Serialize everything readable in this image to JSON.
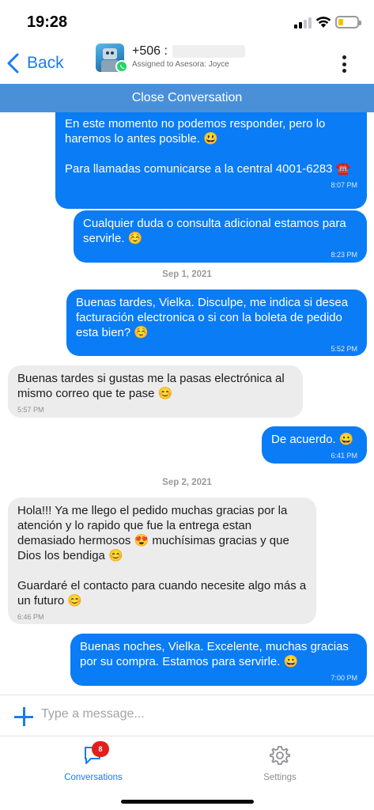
{
  "status_bar": {
    "time": "19:28"
  },
  "header": {
    "back_label": "Back",
    "contact_name": "+506 :",
    "assigned_to": "Assigned to Asesora: Joyce",
    "icons": {
      "back": "chevron-left-icon",
      "more": "vertical-dots-icon",
      "channel": "whatsapp-icon"
    }
  },
  "close_bar": {
    "label": "Close Conversation"
  },
  "messages": [
    {
      "direction": "out",
      "text": "En este momento no podemos responder, pero lo haremos lo antes posible. 😃\n\nPara llamadas comunicarse a la central 4001-6283 ☎️",
      "time": "8:07 PM"
    },
    {
      "direction": "out",
      "text": "Cualquier duda o consulta adicional estamos para servirle. ☺️",
      "time": "8:23 PM"
    },
    {
      "type": "date",
      "text": "Sep 1, 2021"
    },
    {
      "direction": "out",
      "text": "Buenas tardes, Vielka. Disculpe, me indica si desea facturación electronica o si con la boleta de pedido esta bien? ☺️",
      "time": "5:52 PM"
    },
    {
      "direction": "in",
      "text": "Buenas tardes si gustas me la pasas electrónica al mismo correo que te pase 😊",
      "time": "5:57 PM"
    },
    {
      "direction": "out",
      "text": "De acuerdo. 😀",
      "time": "6:41 PM"
    },
    {
      "type": "date",
      "text": "Sep 2, 2021"
    },
    {
      "direction": "in",
      "text": "Hola!!! Ya me llego el pedido muchas gracias por la atención y lo  rapido que fue la entrega estan demasiado hermosos 😍 muchísimas gracias y que Dios los bendiga 😊\n\nGuardaré el contacto para cuando necesite algo más a un futuro 😊",
      "time": "6:46 PM"
    },
    {
      "direction": "out",
      "text": "Buenas noches, Vielka. Excelente, muchas gracias por su compra. Estamos para servirle. 😀",
      "time": "7:00 PM"
    }
  ],
  "composer": {
    "placeholder": "Type a message..."
  },
  "tabs": [
    {
      "label": "Conversations",
      "badge": "8",
      "active": true,
      "icon": "chat-bubble-icon"
    },
    {
      "label": "Settings",
      "active": false,
      "icon": "gear-icon"
    }
  ],
  "colors": {
    "accent": "#1a7cf0",
    "outgoing_bubble": "#0a7cf5",
    "incoming_bubble": "#ececec",
    "close_bar": "#4a90d9",
    "badge": "#e0201a"
  }
}
